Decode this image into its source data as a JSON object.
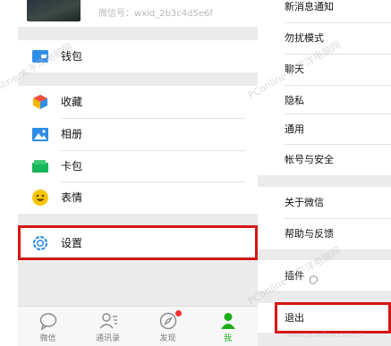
{
  "left_screen": {
    "profile": {
      "id_text": "微信号：wxid_2b3c4d5e6f"
    },
    "menu": {
      "wallet": "钱包",
      "favorites": "收藏",
      "album": "相册",
      "cards": "卡包",
      "stickers": "表情",
      "settings": "设置"
    },
    "tabs": [
      {
        "label": "微信"
      },
      {
        "label": "通讯录"
      },
      {
        "label": "发现"
      },
      {
        "label": "我"
      }
    ]
  },
  "right_screen": {
    "items": {
      "notifications": "新消息通知",
      "do_not_disturb": "勿扰模式",
      "chat": "聊天",
      "privacy": "隐私",
      "general": "通用",
      "account_security": "帐号与安全",
      "about": "关于微信",
      "help_feedback": "帮助与反馈",
      "plugins": "插件",
      "logout": "退出"
    }
  },
  "watermark": {
    "text": "PConline 太平洋电脑网",
    "url": "www.pconline.com.cn"
  },
  "colors": {
    "highlight_border": "#d51515",
    "active_tab": "#1aad19",
    "badge": "#f43530",
    "page_bg": "#ebebeb"
  }
}
